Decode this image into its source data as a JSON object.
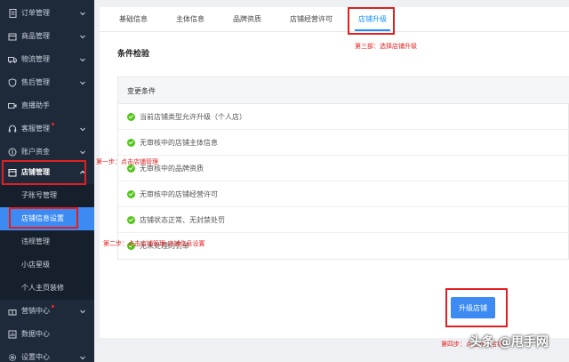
{
  "sidebar": {
    "items": [
      {
        "label": "订单管理",
        "icon": "document-icon"
      },
      {
        "label": "商品管理",
        "icon": "box-icon"
      },
      {
        "label": "物流管理",
        "icon": "truck-icon"
      },
      {
        "label": "售后管理",
        "icon": "shield-icon"
      },
      {
        "label": "直播助手",
        "icon": "video-icon"
      },
      {
        "label": "客服管理",
        "icon": "headset-icon"
      },
      {
        "label": "账户资金",
        "icon": "wallet-icon"
      },
      {
        "label": "店铺管理",
        "icon": "store-icon"
      },
      {
        "label": "营销中心",
        "icon": "gift-icon"
      },
      {
        "label": "数据中心",
        "icon": "chart-icon"
      },
      {
        "label": "设置中心",
        "icon": "gear-icon"
      }
    ],
    "subitems": [
      "子账号管理",
      "店铺信息设置",
      "违规管理",
      "小店星级",
      "个人主页装修"
    ]
  },
  "tabs": [
    "基础信息",
    "主体信息",
    "品牌资质",
    "店铺经营许可",
    "店铺升级"
  ],
  "section_title": "条件检验",
  "conditions": {
    "header": "变更条件",
    "rows": [
      "当前店铺类型允许升级（个人店）",
      "无审核中的店铺主体信息",
      "无审核中的品牌资质",
      "无审核中的店铺经营许可",
      "店铺状态正常、无封禁处罚",
      "无未处理的罚单"
    ]
  },
  "upgrade_button": "升级店铺",
  "annotations": {
    "step1": "第一步：点击店铺管理",
    "step2": "第二步：点击店铺管理-店铺信息设置",
    "step3": "第三部：选择店铺升级",
    "step4": "第四步：点击升级店铺"
  },
  "watermark": "头条 @甩手网",
  "colors": {
    "accent": "#1890ff",
    "sidebar": "#1e2a3a",
    "annotation": "#e02020",
    "success": "#52c41a"
  }
}
